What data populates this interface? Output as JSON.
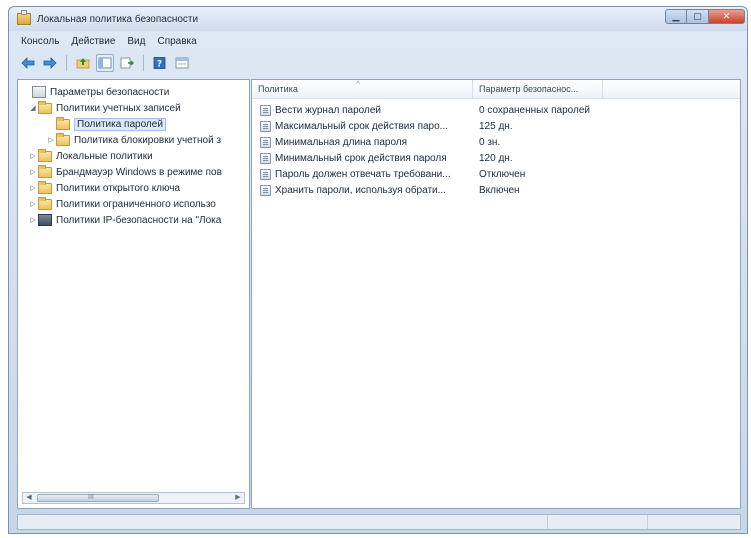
{
  "window": {
    "title": "Локальная политика безопасности"
  },
  "menu": [
    {
      "label": "Консоль"
    },
    {
      "label": "Действие"
    },
    {
      "label": "Вид"
    },
    {
      "label": "Справка"
    }
  ],
  "toolbar": {
    "icons": [
      "back-icon",
      "forward-icon",
      "up-folder-icon",
      "show-hide-tree-icon",
      "export-list-icon",
      "help-icon",
      "properties-icon"
    ]
  },
  "tree": {
    "root": "Параметры безопасности",
    "items": [
      {
        "label": "Политики учетных записей"
      },
      {
        "label": "Политика паролей"
      },
      {
        "label": "Политика блокировки учетной з"
      },
      {
        "label": "Локальные политики"
      },
      {
        "label": "Брандмауэр Windows в режиме пов"
      },
      {
        "label": "Политики открытого ключа"
      },
      {
        "label": "Политики ограниченного использо"
      },
      {
        "label": "Политики IP-безопасности на \"Лока"
      }
    ],
    "scroll_grip": "III"
  },
  "table": {
    "columns": [
      "Политика",
      "Параметр безопаснос..."
    ],
    "rows": [
      {
        "policy": "Вести журнал паролей",
        "value": "0 сохраненных паролей"
      },
      {
        "policy": "Максимальный срок действия паро...",
        "value": "125 дн."
      },
      {
        "policy": "Минимальная длина пароля",
        "value": "0 зн."
      },
      {
        "policy": "Минимальный срок действия пароля",
        "value": "120 дн."
      },
      {
        "policy": "Пароль должен отвечать требовани...",
        "value": "Отключен"
      },
      {
        "policy": "Хранить пароли, используя обрати...",
        "value": "Включен"
      }
    ]
  },
  "colors": {
    "accent": "#3a6ea5",
    "close_button": "#c9442a",
    "selection": "#dce9f8"
  }
}
